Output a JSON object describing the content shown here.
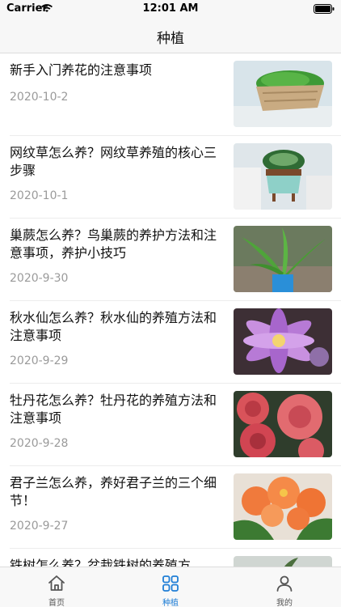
{
  "status": {
    "carrier": "Carrier",
    "time": "12:01 AM"
  },
  "nav": {
    "title": "种植"
  },
  "articles": [
    {
      "title": "新手入门养花的注意事项",
      "date": "2020-10-2",
      "thumb": "moss-planter"
    },
    {
      "title": "网纹草怎么养？网纹草养殖的核心三步骤",
      "date": "2020-10-1",
      "thumb": "fittonia-pot"
    },
    {
      "title": "巢蕨怎么养？鸟巢蕨的养护方法和注意事项，养护小技巧",
      "date": "2020-9-30",
      "thumb": "birds-nest-fern"
    },
    {
      "title": "秋水仙怎么养？秋水仙的养殖方法和注意事项",
      "date": "2020-9-29",
      "thumb": "colchicum-flower"
    },
    {
      "title": "牡丹花怎么养？牡丹花的养殖方法和注意事项",
      "date": "2020-9-28",
      "thumb": "peony-flowers"
    },
    {
      "title": "君子兰怎么养，养好君子兰的三个细节！",
      "date": "2020-9-27",
      "thumb": "clivia-flowers"
    },
    {
      "title": "铁树怎么养？盆栽铁树的养殖方",
      "date": "",
      "thumb": "cycad"
    }
  ],
  "tabs": [
    {
      "label": "首页",
      "icon": "home-icon",
      "active": false
    },
    {
      "label": "种植",
      "icon": "grid-icon",
      "active": true
    },
    {
      "label": "我的",
      "icon": "user-icon",
      "active": false
    }
  ],
  "colors": {
    "accent": "#1f7ed6",
    "date": "#9a9a9a",
    "bar": "#f7f7f7"
  }
}
